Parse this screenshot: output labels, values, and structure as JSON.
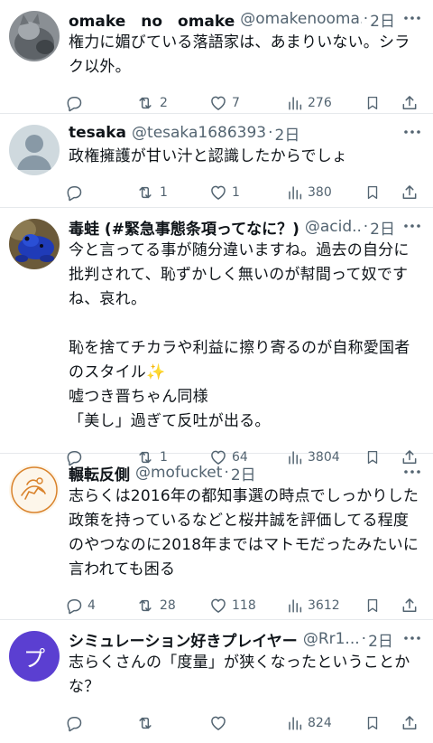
{
  "tweets": [
    {
      "avatar": "gray-cat-avatar",
      "name": "omake　no　omake",
      "handle": "@omakenooma...",
      "time": "2日",
      "text": "権力に媚びている落語家は、あまりいない。シラク以外。",
      "replies": "",
      "retweets": "2",
      "likes": "7",
      "views": "276"
    },
    {
      "avatar": "default-avatar",
      "name": "tesaka",
      "handle": "@tesaka1686393",
      "time": "2日",
      "text": "政権擁護が甘い汁と認識したからでしょ",
      "replies": "",
      "retweets": "1",
      "likes": "1",
      "views": "380"
    },
    {
      "avatar": "blue-frog-avatar",
      "name": "毒蛙 (#緊急事態条項ってなに？)",
      "handle": "@acid...",
      "time": "2日",
      "text": "今と言ってる事が随分違いますね。過去の自分に批判されて、恥ずかしく無いのが幇間って奴ですね、哀れ。\n\n恥を捨てチカラや利益に擦り寄るのが自称愛国者のスタイル",
      "text_emoji": "✨",
      "text_after": "\n嘘つき晋ちゃん同様\n「美し」過ぎて反吐が出る。",
      "replies": "",
      "retweets": "1",
      "likes": "64",
      "views": "3804"
    },
    {
      "avatar": "sketch-avatar",
      "name": "輾転反側",
      "handle": "@mofucket",
      "time": "2日",
      "text": "志らくは2016年の都知事選の時点でしっかりした政策を持っているなどと桜井誠を評価してる程度のやつなのに2018年まではマトモだったみたいに言われても困る",
      "replies": "4",
      "retweets": "28",
      "likes": "118",
      "views": "3612"
    },
    {
      "avatar": "purple-letter-avatar",
      "avatar_letter": "プ",
      "name": "シミュレーション好きプレイヤー",
      "handle": "@Rr1...",
      "time": "2日",
      "text": "志らくさんの「度量」が狭くなったということかな？",
      "replies": "",
      "retweets": "",
      "likes": "",
      "views": "824"
    }
  ],
  "colors": {
    "text": "#0f1419",
    "muted": "#536471",
    "divider": "#e6e9ec",
    "purple_avatar": "#5b3fd1"
  },
  "icons": [
    "more-icon",
    "reply-icon",
    "retweet-icon",
    "like-icon",
    "views-icon",
    "bookmark-icon",
    "share-icon"
  ]
}
